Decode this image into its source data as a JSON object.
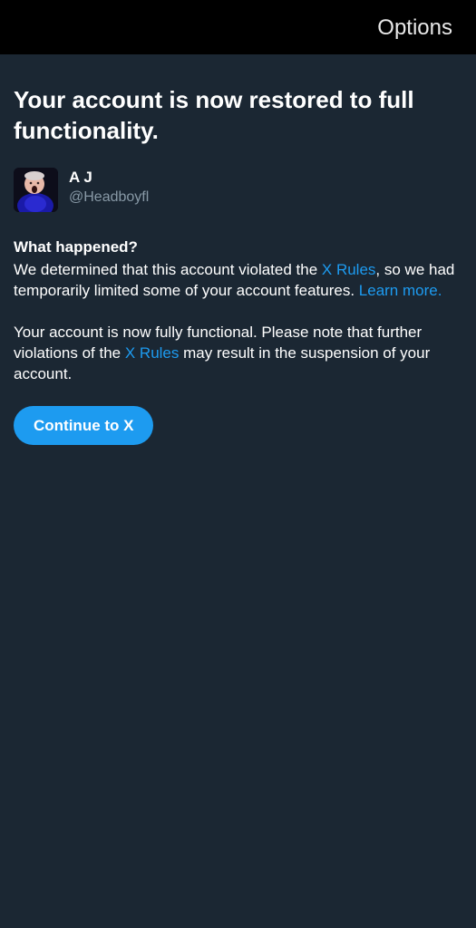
{
  "header": {
    "options_label": "Options"
  },
  "main": {
    "headline": "Your account is now restored to full functionality.",
    "account": {
      "display_name": "A J",
      "handle": "@Headboyfl"
    },
    "section_title": "What happened?",
    "para1": {
      "part1": "We determined that this account violated the ",
      "link1": "X Rules",
      "part2": ", so we had temporarily limited some of your account features. ",
      "link2": "Learn more."
    },
    "para2": {
      "part1": "Your account is now fully functional. Please note that further violations of the ",
      "link1": "X Rules",
      "part2": " may result in the suspension of your account."
    },
    "continue_label": "Continue to X"
  },
  "colors": {
    "background": "#1b2733",
    "top_bar": "#000000",
    "accent": "#1d9bf0",
    "secondary_text": "#8899a6"
  }
}
